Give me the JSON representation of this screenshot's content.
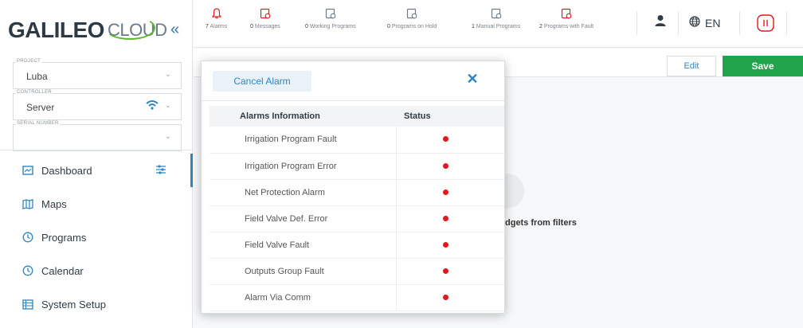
{
  "brand": {
    "name": "GALILEO",
    "cloud": "CLOUD",
    "accent": "#2e86c1",
    "cloud_arc": "#5bbb2e"
  },
  "sidebar": {
    "collapse_glyph": "«",
    "fields": [
      {
        "label": "PROJECT",
        "value": "Luba"
      },
      {
        "label": "CONTROLLER",
        "value": "Server"
      },
      {
        "label": "SERIAL NUMBER",
        "value": ""
      }
    ],
    "nav": [
      {
        "label": "Dashboard",
        "icon": "dashboard-icon",
        "active": true
      },
      {
        "label": "Maps",
        "icon": "map-icon"
      },
      {
        "label": "Programs",
        "icon": "clock-icon"
      },
      {
        "label": "Calendar",
        "icon": "clock-icon"
      },
      {
        "label": "System Setup",
        "icon": "list-icon"
      }
    ]
  },
  "topbar": {
    "items": [
      {
        "count": "7",
        "label": "Alarms",
        "icon": "bell-icon"
      },
      {
        "count": "0",
        "label": "Messages",
        "icon": "message-icon"
      },
      {
        "count": "0",
        "label": "Working Programs",
        "icon": "program-icon"
      },
      {
        "count": "0",
        "label": "Programs on Hold",
        "icon": "program-icon"
      },
      {
        "count": "1",
        "label": "Manual Programs",
        "icon": "program-icon"
      },
      {
        "count": "2",
        "label": "Programs with Fault",
        "icon": "program-fault-icon"
      }
    ],
    "language": "EN"
  },
  "main": {
    "edit_label": "Edit",
    "save_label": "Save",
    "empty_text": "dgets from filters",
    "save_color": "#20a44a"
  },
  "modal": {
    "cancel_label": "Cancel Alarm",
    "close_glyph": "✕",
    "columns": [
      "Alarms Information",
      "Status"
    ],
    "rows": [
      {
        "name": "Irrigation Program Fault",
        "status": "active"
      },
      {
        "name": "Irrigation Program Error",
        "status": "active"
      },
      {
        "name": "Net Protection Alarm",
        "status": "active"
      },
      {
        "name": "Field Valve Def. Error",
        "status": "active"
      },
      {
        "name": "Field Valve Fault",
        "status": "active"
      },
      {
        "name": "Outputs Group Fault",
        "status": "active"
      },
      {
        "name": "Alarm Via Comm",
        "status": "active"
      }
    ],
    "status_color": "#e0191e"
  }
}
